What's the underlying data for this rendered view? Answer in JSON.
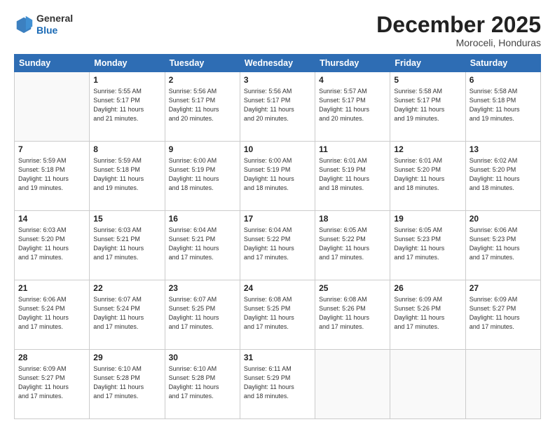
{
  "header": {
    "logo_line1": "General",
    "logo_line2": "Blue",
    "month_title": "December 2025",
    "location": "Moroceli, Honduras"
  },
  "columns": [
    "Sunday",
    "Monday",
    "Tuesday",
    "Wednesday",
    "Thursday",
    "Friday",
    "Saturday"
  ],
  "weeks": [
    [
      {
        "day": "",
        "info": ""
      },
      {
        "day": "1",
        "info": "Sunrise: 5:55 AM\nSunset: 5:17 PM\nDaylight: 11 hours\nand 21 minutes."
      },
      {
        "day": "2",
        "info": "Sunrise: 5:56 AM\nSunset: 5:17 PM\nDaylight: 11 hours\nand 20 minutes."
      },
      {
        "day": "3",
        "info": "Sunrise: 5:56 AM\nSunset: 5:17 PM\nDaylight: 11 hours\nand 20 minutes."
      },
      {
        "day": "4",
        "info": "Sunrise: 5:57 AM\nSunset: 5:17 PM\nDaylight: 11 hours\nand 20 minutes."
      },
      {
        "day": "5",
        "info": "Sunrise: 5:58 AM\nSunset: 5:17 PM\nDaylight: 11 hours\nand 19 minutes."
      },
      {
        "day": "6",
        "info": "Sunrise: 5:58 AM\nSunset: 5:18 PM\nDaylight: 11 hours\nand 19 minutes."
      }
    ],
    [
      {
        "day": "7",
        "info": "Sunrise: 5:59 AM\nSunset: 5:18 PM\nDaylight: 11 hours\nand 19 minutes."
      },
      {
        "day": "8",
        "info": "Sunrise: 5:59 AM\nSunset: 5:18 PM\nDaylight: 11 hours\nand 19 minutes."
      },
      {
        "day": "9",
        "info": "Sunrise: 6:00 AM\nSunset: 5:19 PM\nDaylight: 11 hours\nand 18 minutes."
      },
      {
        "day": "10",
        "info": "Sunrise: 6:00 AM\nSunset: 5:19 PM\nDaylight: 11 hours\nand 18 minutes."
      },
      {
        "day": "11",
        "info": "Sunrise: 6:01 AM\nSunset: 5:19 PM\nDaylight: 11 hours\nand 18 minutes."
      },
      {
        "day": "12",
        "info": "Sunrise: 6:01 AM\nSunset: 5:20 PM\nDaylight: 11 hours\nand 18 minutes."
      },
      {
        "day": "13",
        "info": "Sunrise: 6:02 AM\nSunset: 5:20 PM\nDaylight: 11 hours\nand 18 minutes."
      }
    ],
    [
      {
        "day": "14",
        "info": "Sunrise: 6:03 AM\nSunset: 5:20 PM\nDaylight: 11 hours\nand 17 minutes."
      },
      {
        "day": "15",
        "info": "Sunrise: 6:03 AM\nSunset: 5:21 PM\nDaylight: 11 hours\nand 17 minutes."
      },
      {
        "day": "16",
        "info": "Sunrise: 6:04 AM\nSunset: 5:21 PM\nDaylight: 11 hours\nand 17 minutes."
      },
      {
        "day": "17",
        "info": "Sunrise: 6:04 AM\nSunset: 5:22 PM\nDaylight: 11 hours\nand 17 minutes."
      },
      {
        "day": "18",
        "info": "Sunrise: 6:05 AM\nSunset: 5:22 PM\nDaylight: 11 hours\nand 17 minutes."
      },
      {
        "day": "19",
        "info": "Sunrise: 6:05 AM\nSunset: 5:23 PM\nDaylight: 11 hours\nand 17 minutes."
      },
      {
        "day": "20",
        "info": "Sunrise: 6:06 AM\nSunset: 5:23 PM\nDaylight: 11 hours\nand 17 minutes."
      }
    ],
    [
      {
        "day": "21",
        "info": "Sunrise: 6:06 AM\nSunset: 5:24 PM\nDaylight: 11 hours\nand 17 minutes."
      },
      {
        "day": "22",
        "info": "Sunrise: 6:07 AM\nSunset: 5:24 PM\nDaylight: 11 hours\nand 17 minutes."
      },
      {
        "day": "23",
        "info": "Sunrise: 6:07 AM\nSunset: 5:25 PM\nDaylight: 11 hours\nand 17 minutes."
      },
      {
        "day": "24",
        "info": "Sunrise: 6:08 AM\nSunset: 5:25 PM\nDaylight: 11 hours\nand 17 minutes."
      },
      {
        "day": "25",
        "info": "Sunrise: 6:08 AM\nSunset: 5:26 PM\nDaylight: 11 hours\nand 17 minutes."
      },
      {
        "day": "26",
        "info": "Sunrise: 6:09 AM\nSunset: 5:26 PM\nDaylight: 11 hours\nand 17 minutes."
      },
      {
        "day": "27",
        "info": "Sunrise: 6:09 AM\nSunset: 5:27 PM\nDaylight: 11 hours\nand 17 minutes."
      }
    ],
    [
      {
        "day": "28",
        "info": "Sunrise: 6:09 AM\nSunset: 5:27 PM\nDaylight: 11 hours\nand 17 minutes."
      },
      {
        "day": "29",
        "info": "Sunrise: 6:10 AM\nSunset: 5:28 PM\nDaylight: 11 hours\nand 17 minutes."
      },
      {
        "day": "30",
        "info": "Sunrise: 6:10 AM\nSunset: 5:28 PM\nDaylight: 11 hours\nand 17 minutes."
      },
      {
        "day": "31",
        "info": "Sunrise: 6:11 AM\nSunset: 5:29 PM\nDaylight: 11 hours\nand 18 minutes."
      },
      {
        "day": "",
        "info": ""
      },
      {
        "day": "",
        "info": ""
      },
      {
        "day": "",
        "info": ""
      }
    ]
  ]
}
